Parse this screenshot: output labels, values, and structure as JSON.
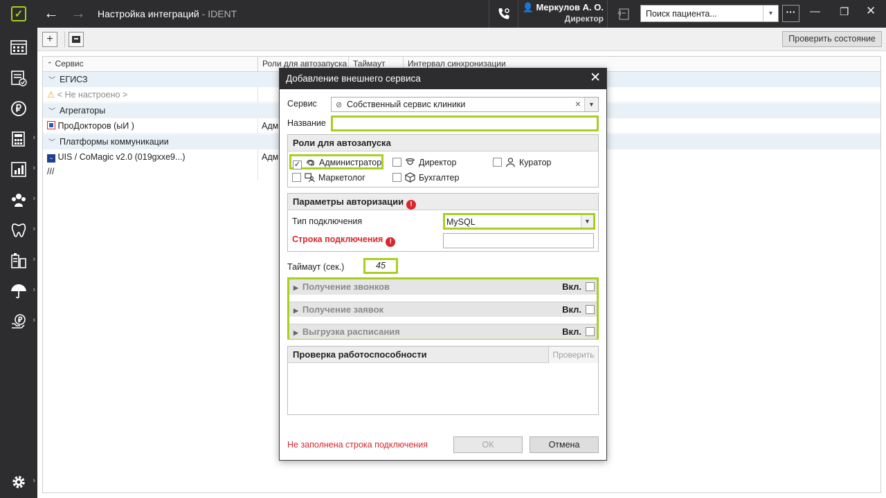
{
  "app": {
    "title": "Настройка интеграций",
    "app_name": "IDENT",
    "title_sep": " - "
  },
  "user": {
    "name": "Меркулов А. О.",
    "role": "Директор"
  },
  "search": {
    "placeholder": "Поиск пациента..."
  },
  "toolbar": {
    "add_label": "+",
    "check_state_label": "Проверить состояние"
  },
  "grid": {
    "columns": [
      "Сервис",
      "Роли для автозапуска",
      "Таймаут",
      "Интервал синхронизации"
    ],
    "groups": [
      {
        "label": "ЕГИСЗ",
        "rows": [
          {
            "name": "< Не настроено >",
            "roles": ""
          }
        ]
      },
      {
        "label": "Агрегаторы",
        "rows": [
          {
            "name": "ПроДокторов (ыИ )",
            "roles": "Адм"
          }
        ]
      },
      {
        "label": "Платформы коммуникации",
        "rows": [
          {
            "name": "UIS / CoMagic v2.0 (019gxxe9...)",
            "roles": "Адм"
          },
          {
            "name": "///",
            "roles": ""
          }
        ]
      }
    ]
  },
  "modal": {
    "title": "Добавление внешнего сервиса",
    "service_label": "Сервис",
    "service_value": "Собственный сервис клиники",
    "name_label": "Название",
    "name_value": "",
    "roles_title": "Роли для автозапуска",
    "roles": [
      {
        "label": "Администратор",
        "checked": true,
        "icon": "headset-icon"
      },
      {
        "label": "Директор",
        "checked": false,
        "icon": "director-icon"
      },
      {
        "label": "Куратор",
        "checked": false,
        "icon": "person-icon"
      },
      {
        "label": "Маркетолог",
        "checked": false,
        "icon": "marketer-icon"
      },
      {
        "label": "Бухгалтер",
        "checked": false,
        "icon": "box-icon"
      }
    ],
    "auth_title": "Параметры авторизации",
    "conn_type_label": "Тип подключения",
    "conn_type_value": "MySQL",
    "conn_string_label": "Строка подключения",
    "conn_string_value": "",
    "timeout_label": "Таймаут (сек.)",
    "timeout_value": "45",
    "collapsibles": [
      {
        "label": "Получение звонков",
        "toggle_label": "Вкл.",
        "enabled": false
      },
      {
        "label": "Получение заявок",
        "toggle_label": "Вкл.",
        "enabled": false
      },
      {
        "label": "Выгрузка расписания",
        "toggle_label": "Вкл.",
        "enabled": false
      }
    ],
    "health_title": "Проверка работоспособности",
    "health_check_label": "Проверить",
    "error_text": "Не заполнена строка подключения",
    "ok_label": "ОК",
    "cancel_label": "Отмена"
  },
  "colors": {
    "accent": "#a8cf1f",
    "chrome": "#2d2d30",
    "error": "#d9252c",
    "group_bg": "#e9f1f8"
  }
}
